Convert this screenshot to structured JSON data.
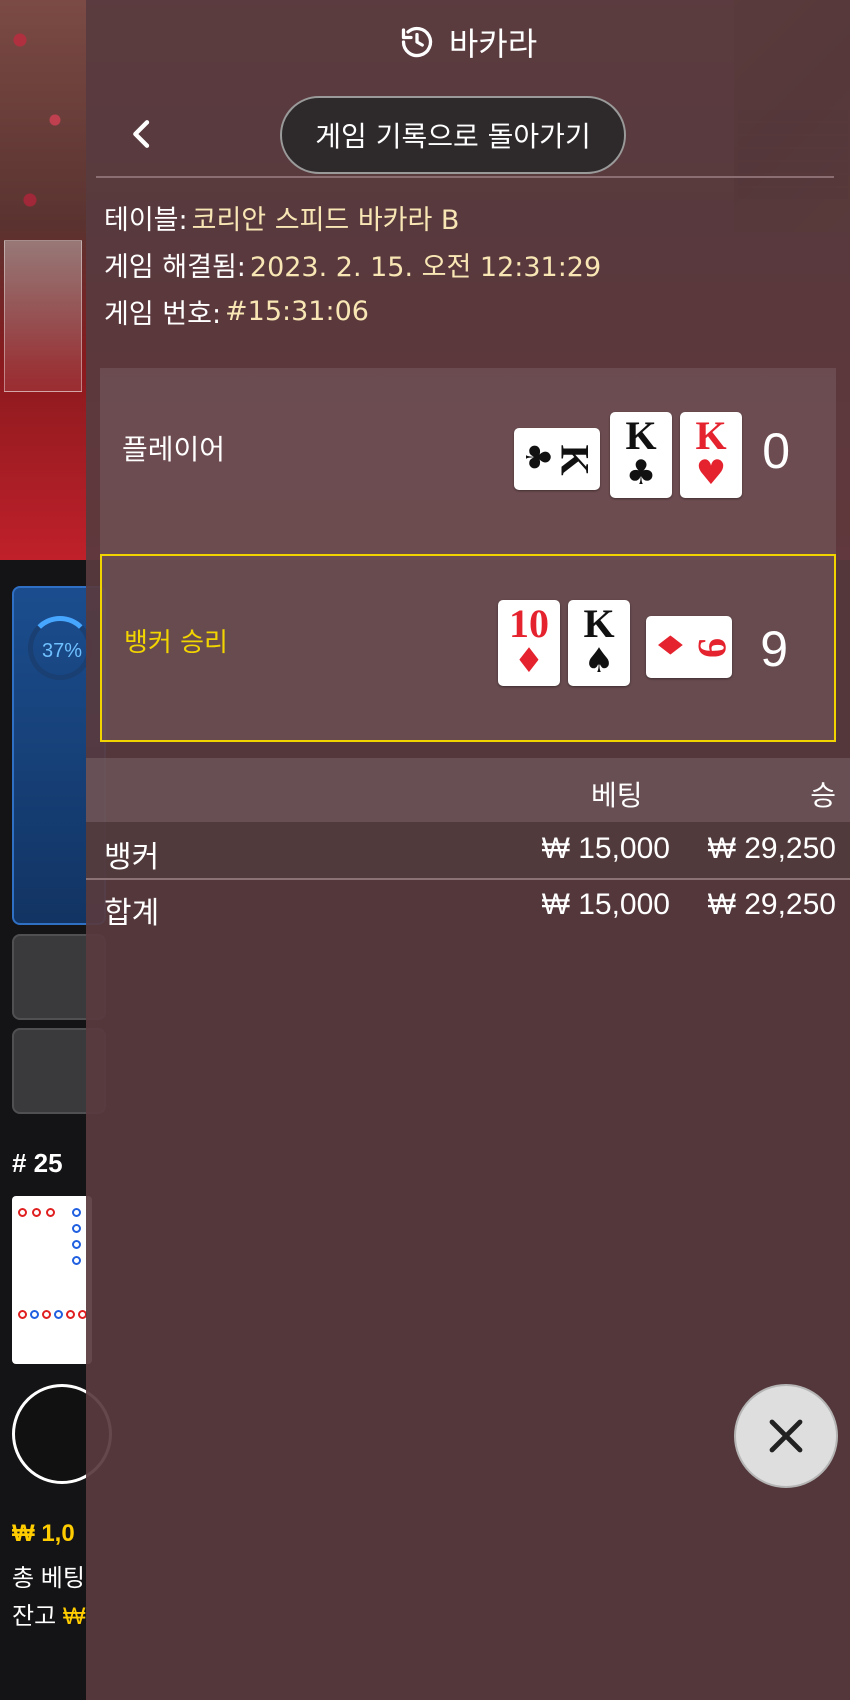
{
  "background": {
    "timer_percent": "37%",
    "round": "# 25",
    "balance": "₩ 1,0",
    "total_bet_label": "총 베팅",
    "remaining_label": "잔고",
    "remaining_value": "₩"
  },
  "header": {
    "title": "바카라",
    "icon": "history-icon"
  },
  "nav": {
    "back_label": "게임 기록으로 돌아가기"
  },
  "info": {
    "table_label": "테이블:",
    "table_value": "코리안 스피드 바카라 B",
    "resolved_label": "게임 해결됨:",
    "resolved_value": "2023. 2. 15. 오전 12:31:29",
    "game_no_label": "게임 번호:",
    "game_no_value": "#15:31:06"
  },
  "player": {
    "label": "플레이어",
    "score": "0",
    "cards": [
      {
        "rank": "K",
        "suit": "♣",
        "color": "#111111",
        "orientation": "horizontal"
      },
      {
        "rank": "K",
        "suit": "♣",
        "color": "#111111",
        "orientation": "vertical"
      },
      {
        "rank": "K",
        "suit": "♥",
        "color": "#e5232e",
        "orientation": "vertical"
      }
    ]
  },
  "banker": {
    "label": "뱅커 승리",
    "score": "9",
    "highlight_color": "#f2d400",
    "cards": [
      {
        "rank": "10",
        "suit": "♦",
        "color": "#e5232e",
        "orientation": "vertical"
      },
      {
        "rank": "K",
        "suit": "♠",
        "color": "#111111",
        "orientation": "vertical"
      },
      {
        "rank": "9",
        "suit": "♦",
        "color": "#e5232e",
        "orientation": "horizontal"
      }
    ]
  },
  "table": {
    "headers": {
      "bet": "베팅",
      "win": "승"
    },
    "rows": [
      {
        "name": "뱅커",
        "bet": "₩ 15,000",
        "win": "₩ 29,250"
      }
    ],
    "total": {
      "name": "합계",
      "bet": "₩ 15,000",
      "win": "₩ 29,250"
    }
  },
  "close": {
    "icon": "close-icon"
  }
}
